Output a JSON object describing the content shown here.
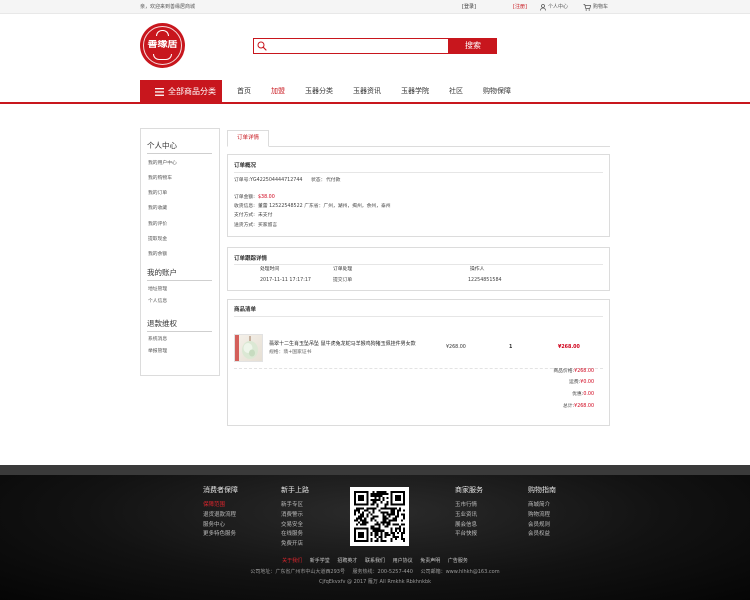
{
  "topbar": {
    "welcome": "亲，欢迎来到善缘居商城",
    "login": "[登录]",
    "register": "[注册]",
    "user_center": "个人中心",
    "cart": "购物车"
  },
  "header": {
    "logo_text": "善缘居",
    "search_placeholder": "",
    "search_button": "搜索"
  },
  "nav": {
    "category_button": "全部商品分类",
    "items": [
      "首页",
      "加盟",
      "玉器分类",
      "玉器资讯",
      "玉器学院",
      "社区",
      "购物保障"
    ],
    "active_index": 1
  },
  "sidebar": {
    "sections": [
      {
        "title": "个人中心",
        "items": [
          "我的用户中心",
          "我的购物车",
          "我的订单",
          "我的收藏",
          "我的评价",
          "提取现金",
          "我的余额"
        ]
      },
      {
        "title": "我的账户",
        "items": [
          "地址管理",
          "个人信息"
        ]
      },
      {
        "title": "退款维权",
        "items": [
          "系统消息",
          "举报管理"
        ]
      }
    ]
  },
  "order": {
    "tab": "订单详情",
    "overview": {
      "title": "订单概况",
      "order_no": "订单号:YG422504444712744",
      "status_label": "状态：",
      "status": "代付款",
      "amount_label": "订单金额:",
      "amount": "$38.00",
      "receiver_label": "收货信息:",
      "receiver": "董蕾  12522548522 广东省：广州，湖州，揭州，余州，泰州",
      "payment_label": "支付方式:",
      "payment": "未支付",
      "delivery_label": "送货方式:",
      "delivery": "买家留言"
    },
    "tracking": {
      "title": "订单跟踪详情",
      "columns": [
        "处理时间",
        "订单处理",
        "操作人"
      ],
      "rows": [
        [
          "2017-11-11  17:17:17",
          "提交订单",
          "12254851584"
        ]
      ]
    },
    "items": {
      "title": "商品清单",
      "products": [
        {
          "name": "翡翠十二生肖玉坠吊坠 鼠牛虎兔龙蛇马羊猴鸡狗猪玉佩挂件男女款",
          "spec": "规格：翡+国家证书",
          "price": "¥268.00",
          "qty": "1",
          "total": "¥268.00"
        }
      ]
    },
    "summary": [
      {
        "label": "商品价格:",
        "value": "¥268.00"
      },
      {
        "label": "运费:",
        "value": "¥0.00"
      },
      {
        "label": "优惠:",
        "value": "0.00"
      },
      {
        "label": "总计:",
        "value": "¥268.00"
      }
    ]
  },
  "footer": {
    "columns": [
      {
        "title": "消费者保障",
        "items": [
          "保障范围",
          "退货退款流程",
          "服务中心",
          "更多特色服务"
        ]
      },
      {
        "title": "新手上路",
        "items": [
          "新手专区",
          "消费警示",
          "交易安全",
          "在线服务",
          "免费开店"
        ]
      },
      {
        "title": "商家服务",
        "items": [
          "玉市行情",
          "玉业资讯",
          "展会信息",
          "平台快报"
        ]
      },
      {
        "title": "购物指南",
        "items": [
          "商城简介",
          "购物流程",
          "会员规则",
          "会员权益"
        ]
      }
    ],
    "links": [
      "关于我们",
      "新手学堂",
      "招聘英才",
      "联系我们",
      "用户协议",
      "免责声明",
      "广告服务"
    ],
    "address": "公司地址：广东省广州市中山大道西293号",
    "hotline": "服务热线：200-5257-440",
    "email": "公司邮箱：www.hlhkh@163.com",
    "copyright": "CjfqEkvxfv @ 2017  雁万 All Rmkhk Rbkhnkbk"
  },
  "icons": {
    "user": "user-icon",
    "cart": "cart-icon",
    "search": "search-icon",
    "menu": "menu-icon",
    "qr": "qr-code"
  },
  "colors": {
    "brand_red": "#c8161d",
    "price_red": "#d0021b",
    "footer_bg": "#111111"
  }
}
